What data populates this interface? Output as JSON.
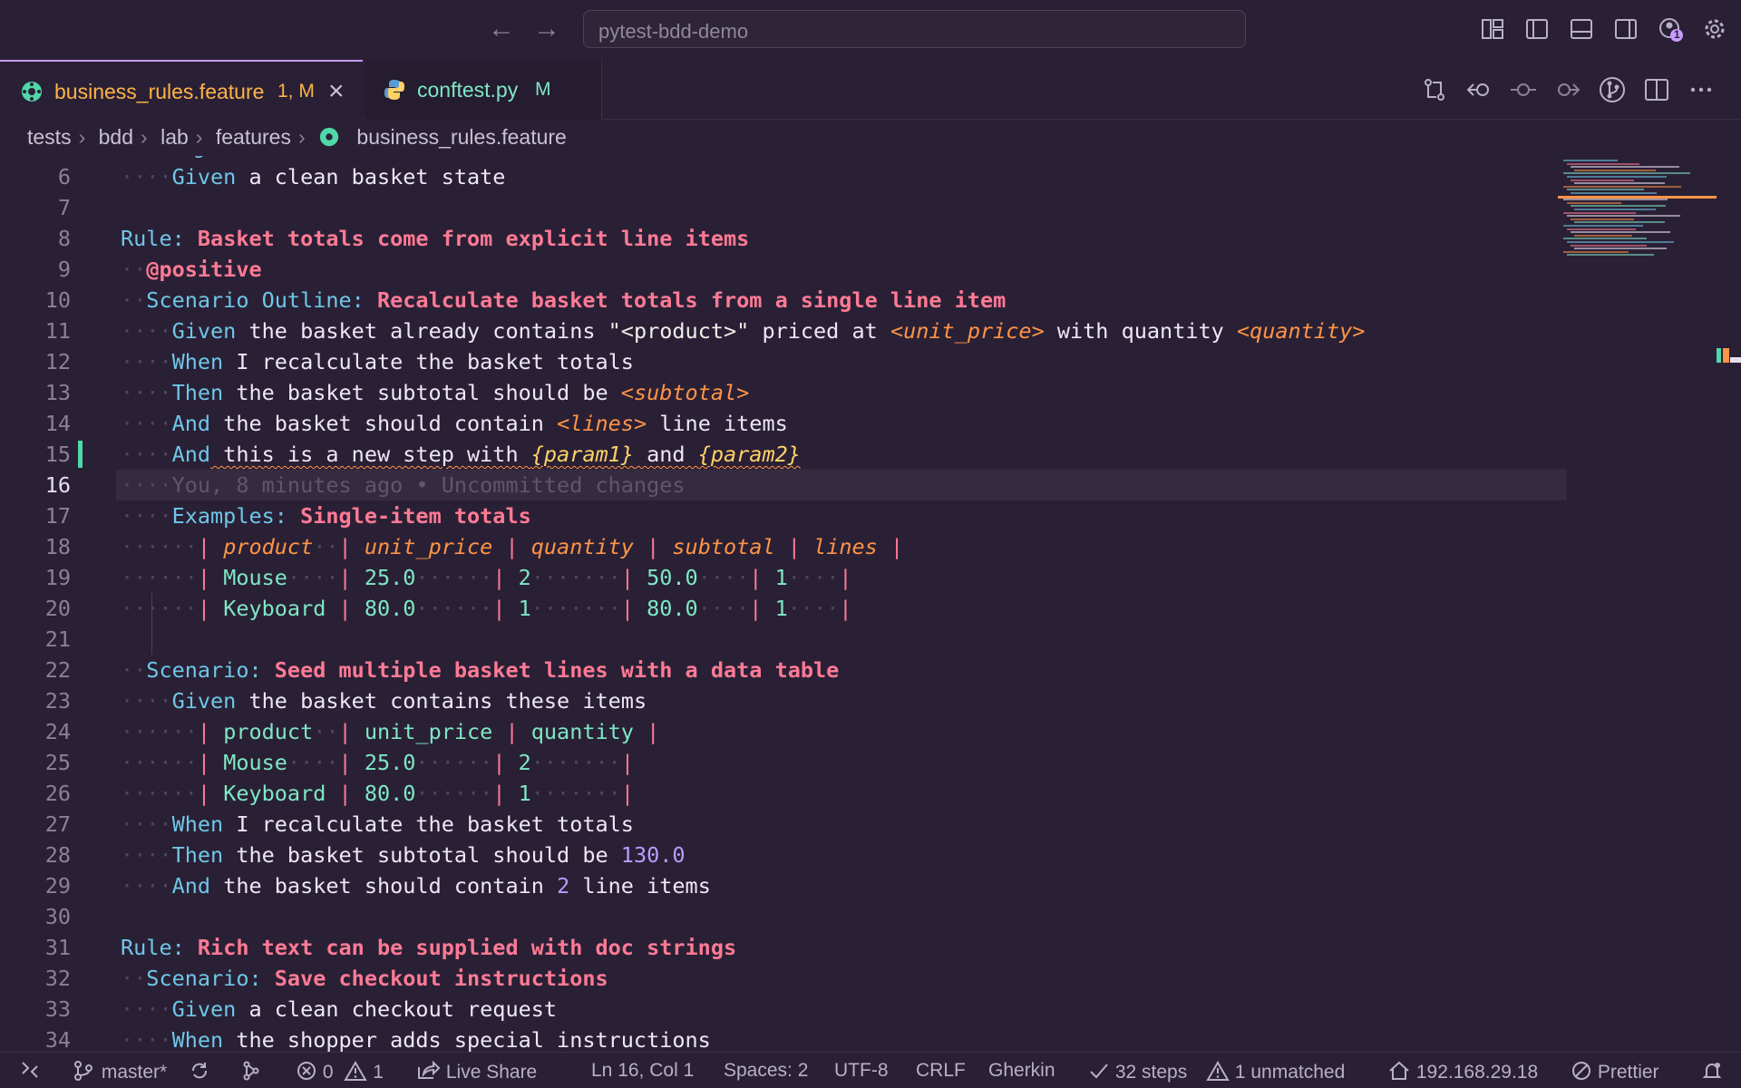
{
  "titlebar": {
    "search": "pytest-bdd-demo",
    "notification_count": "1"
  },
  "tabs": [
    {
      "label": "business_rules.feature",
      "badge": "1, M",
      "active": true
    },
    {
      "label": "conftest.py",
      "badge": "M",
      "active": false
    }
  ],
  "breadcrumb": [
    "tests",
    "bdd",
    "lab",
    "features",
    "business_rules.feature"
  ],
  "editor": {
    "lines": [
      {
        "n": "6",
        "indent": 2,
        "tokens": [
          [
            "kw",
            "Given"
          ],
          [
            "txt",
            " a clean basket state"
          ]
        ]
      },
      {
        "n": "7",
        "indent": 0,
        "tokens": []
      },
      {
        "n": "8",
        "indent": 0,
        "tokens": [
          [
            "kw",
            "Rule:"
          ],
          [
            "ttl",
            " Basket totals come from explicit line items"
          ]
        ]
      },
      {
        "n": "9",
        "indent": 1,
        "tokens": [
          [
            "tag",
            "@positive"
          ]
        ]
      },
      {
        "n": "10",
        "indent": 1,
        "tokens": [
          [
            "kw",
            "Scenario Outline:"
          ],
          [
            "ttl",
            " Recalculate basket totals from a single line item"
          ]
        ]
      },
      {
        "n": "11",
        "indent": 2,
        "tokens": [
          [
            "kw",
            "Given"
          ],
          [
            "txt",
            " the basket already contains "
          ],
          [
            "str",
            "\"<product>\""
          ],
          [
            "txt",
            " priced at "
          ],
          [
            "ph",
            "<unit_price>"
          ],
          [
            "txt",
            " with quantity "
          ],
          [
            "ph",
            "<quantity>"
          ]
        ]
      },
      {
        "n": "12",
        "indent": 2,
        "tokens": [
          [
            "kw",
            "When"
          ],
          [
            "txt",
            " I recalculate the basket totals"
          ]
        ]
      },
      {
        "n": "13",
        "indent": 2,
        "tokens": [
          [
            "kw",
            "Then"
          ],
          [
            "txt",
            " the basket subtotal should be "
          ],
          [
            "ph",
            "<subtotal>"
          ]
        ]
      },
      {
        "n": "14",
        "indent": 2,
        "tokens": [
          [
            "kw",
            "And"
          ],
          [
            "txt",
            " the basket should contain "
          ],
          [
            "ph",
            "<lines>"
          ],
          [
            "txt",
            " line items"
          ]
        ]
      },
      {
        "n": "15",
        "indent": 2,
        "squiggle": true,
        "tokens": [
          [
            "kw",
            "And"
          ],
          [
            "txt",
            " this is a new step with "
          ],
          [
            "param",
            "{param1}"
          ],
          [
            "txt",
            " and "
          ],
          [
            "param",
            "{param2}"
          ]
        ]
      },
      {
        "n": "16",
        "indent": 2,
        "current": true,
        "tokens": [
          [
            "blame",
            "You, 8 minutes ago • Uncommitted changes"
          ]
        ]
      },
      {
        "n": "17",
        "indent": 2,
        "tokens": [
          [
            "kw",
            "Examples:"
          ],
          [
            "ttl",
            " Single-item totals"
          ]
        ]
      },
      {
        "n": "18",
        "indent": 3,
        "tokens": [
          [
            "pipe",
            "| "
          ],
          [
            "th",
            "product"
          ],
          [
            "ws",
            "··"
          ],
          [
            "pipe",
            "| "
          ],
          [
            "th",
            "unit_price"
          ],
          [
            "pipe",
            " | "
          ],
          [
            "th",
            "quantity"
          ],
          [
            "pipe",
            " | "
          ],
          [
            "th",
            "subtotal"
          ],
          [
            "pipe",
            " | "
          ],
          [
            "th",
            "lines"
          ],
          [
            "pipe",
            " |"
          ]
        ]
      },
      {
        "n": "19",
        "indent": 3,
        "tokens": [
          [
            "pipe",
            "| "
          ],
          [
            "td",
            "Mouse"
          ],
          [
            "ws",
            "····"
          ],
          [
            "pipe",
            "| "
          ],
          [
            "td",
            "25.0"
          ],
          [
            "ws",
            "······"
          ],
          [
            "pipe",
            "| "
          ],
          [
            "td",
            "2"
          ],
          [
            "ws",
            "·······"
          ],
          [
            "pipe",
            "| "
          ],
          [
            "td",
            "50.0"
          ],
          [
            "ws",
            "····"
          ],
          [
            "pipe",
            "| "
          ],
          [
            "td",
            "1"
          ],
          [
            "ws",
            "····"
          ],
          [
            "pipe",
            "|"
          ]
        ]
      },
      {
        "n": "20",
        "indent": 3,
        "tokens": [
          [
            "pipe",
            "| "
          ],
          [
            "td",
            "Keyboard"
          ],
          [
            "pipe",
            " | "
          ],
          [
            "td",
            "80.0"
          ],
          [
            "ws",
            "······"
          ],
          [
            "pipe",
            "| "
          ],
          [
            "td",
            "1"
          ],
          [
            "ws",
            "·······"
          ],
          [
            "pipe",
            "| "
          ],
          [
            "td",
            "80.0"
          ],
          [
            "ws",
            "····"
          ],
          [
            "pipe",
            "| "
          ],
          [
            "td",
            "1"
          ],
          [
            "ws",
            "····"
          ],
          [
            "pipe",
            "|"
          ]
        ]
      },
      {
        "n": "21",
        "indent": 0,
        "tokens": []
      },
      {
        "n": "22",
        "indent": 1,
        "tokens": [
          [
            "kw",
            "Scenario:"
          ],
          [
            "ttl",
            " Seed multiple basket lines with a data table"
          ]
        ]
      },
      {
        "n": "23",
        "indent": 2,
        "tokens": [
          [
            "kw",
            "Given"
          ],
          [
            "txt",
            " the basket contains these items"
          ]
        ]
      },
      {
        "n": "24",
        "indent": 3,
        "tokens": [
          [
            "pipe",
            "| "
          ],
          [
            "td",
            "product"
          ],
          [
            "ws",
            "··"
          ],
          [
            "pipe",
            "| "
          ],
          [
            "td",
            "unit_price"
          ],
          [
            "pipe",
            " | "
          ],
          [
            "td",
            "quantity"
          ],
          [
            "pipe",
            " |"
          ]
        ]
      },
      {
        "n": "25",
        "indent": 3,
        "tokens": [
          [
            "pipe",
            "| "
          ],
          [
            "td",
            "Mouse"
          ],
          [
            "ws",
            "····"
          ],
          [
            "pipe",
            "| "
          ],
          [
            "td",
            "25.0"
          ],
          [
            "ws",
            "······"
          ],
          [
            "pipe",
            "| "
          ],
          [
            "td",
            "2"
          ],
          [
            "ws",
            "·······"
          ],
          [
            "pipe",
            "|"
          ]
        ]
      },
      {
        "n": "26",
        "indent": 3,
        "tokens": [
          [
            "pipe",
            "| "
          ],
          [
            "td",
            "Keyboard"
          ],
          [
            "pipe",
            " | "
          ],
          [
            "td",
            "80.0"
          ],
          [
            "ws",
            "······"
          ],
          [
            "pipe",
            "| "
          ],
          [
            "td",
            "1"
          ],
          [
            "ws",
            "·······"
          ],
          [
            "pipe",
            "|"
          ]
        ]
      },
      {
        "n": "27",
        "indent": 2,
        "tokens": [
          [
            "kw",
            "When"
          ],
          [
            "txt",
            " I recalculate the basket totals"
          ]
        ]
      },
      {
        "n": "28",
        "indent": 2,
        "tokens": [
          [
            "kw",
            "Then"
          ],
          [
            "txt",
            " the basket subtotal should be "
          ],
          [
            "num",
            "130.0"
          ]
        ]
      },
      {
        "n": "29",
        "indent": 2,
        "tokens": [
          [
            "kw",
            "And"
          ],
          [
            "txt",
            " the basket should contain "
          ],
          [
            "num",
            "2"
          ],
          [
            "txt",
            " line items"
          ]
        ]
      },
      {
        "n": "30",
        "indent": 0,
        "tokens": []
      },
      {
        "n": "31",
        "indent": 0,
        "tokens": [
          [
            "kw",
            "Rule:"
          ],
          [
            "ttl",
            " Rich text can be supplied with doc strings"
          ]
        ]
      },
      {
        "n": "32",
        "indent": 1,
        "tokens": [
          [
            "kw",
            "Scenario:"
          ],
          [
            "ttl",
            " Save checkout instructions"
          ]
        ]
      },
      {
        "n": "33",
        "indent": 2,
        "tokens": [
          [
            "kw",
            "Given"
          ],
          [
            "txt",
            " a clean checkout request"
          ]
        ]
      },
      {
        "n": "34",
        "indent": 2,
        "tokens": [
          [
            "kw",
            "When"
          ],
          [
            "txt",
            " the shopper adds special instructions"
          ]
        ]
      }
    ]
  },
  "statusbar": {
    "branch": "master*",
    "errors": "0",
    "warnings": "1",
    "live_share": "Live Share",
    "position": "Ln 16, Col 1",
    "spaces": "Spaces: 2",
    "encoding": "UTF-8",
    "eol": "CRLF",
    "language": "Gherkin",
    "steps": "32 steps",
    "unmatched": "1 unmatched",
    "host": "192.168.29.18",
    "formatter": "Prettier"
  },
  "colors": {
    "background": "#2a2035",
    "accent": "#c79bff",
    "keyword": "#6ec7e8",
    "title": "#ff7a95",
    "placeholder": "#ff9446",
    "table_cell": "#7ee8c4",
    "modified_gutter": "#4fd8a8"
  }
}
